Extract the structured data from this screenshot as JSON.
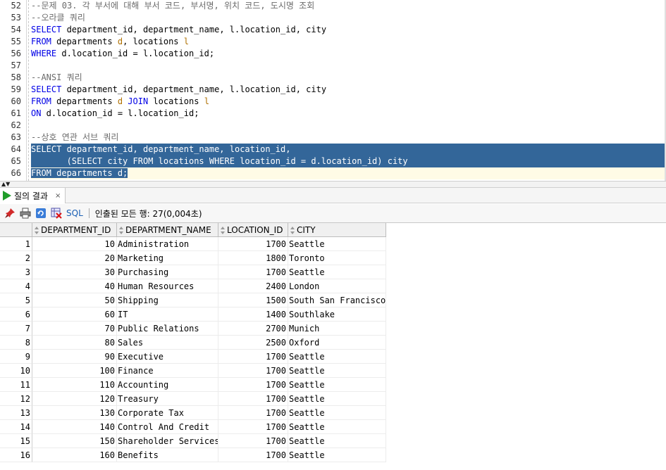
{
  "editor": {
    "lines": [
      {
        "n": "52",
        "segs": [
          {
            "t": "--문제 03. 각 부서에 대해 부서 코드, 부서명, 위치 코드, 도시명 조회",
            "c": "cm"
          }
        ]
      },
      {
        "n": "53",
        "segs": [
          {
            "t": "--오라클 쿼리",
            "c": "cm"
          }
        ]
      },
      {
        "n": "54",
        "segs": [
          {
            "t": "SELECT",
            "c": "kw"
          },
          {
            "t": " department_id, department_name, l.location_id, city",
            "c": ""
          }
        ]
      },
      {
        "n": "55",
        "segs": [
          {
            "t": "FROM",
            "c": "kw"
          },
          {
            "t": " departments ",
            "c": ""
          },
          {
            "t": "d",
            "c": "ali"
          },
          {
            "t": ", locations ",
            "c": ""
          },
          {
            "t": "l",
            "c": "ali"
          }
        ]
      },
      {
        "n": "56",
        "segs": [
          {
            "t": "WHERE",
            "c": "kw"
          },
          {
            "t": " d.location_id = l.location_id;",
            "c": ""
          }
        ]
      },
      {
        "n": "57",
        "segs": []
      },
      {
        "n": "58",
        "segs": [
          {
            "t": "--ANSI 쿼리",
            "c": "cm"
          }
        ]
      },
      {
        "n": "59",
        "segs": [
          {
            "t": "SELECT",
            "c": "kw"
          },
          {
            "t": " department_id, department_name, l.location_id, city",
            "c": ""
          }
        ]
      },
      {
        "n": "60",
        "segs": [
          {
            "t": "FROM",
            "c": "kw"
          },
          {
            "t": " departments ",
            "c": ""
          },
          {
            "t": "d",
            "c": "ali"
          },
          {
            "t": " ",
            "c": ""
          },
          {
            "t": "JOIN",
            "c": "kw"
          },
          {
            "t": " locations ",
            "c": ""
          },
          {
            "t": "l",
            "c": "ali"
          }
        ]
      },
      {
        "n": "61",
        "segs": [
          {
            "t": "ON",
            "c": "kw"
          },
          {
            "t": " d.location_id = l.location_id;",
            "c": ""
          }
        ]
      },
      {
        "n": "62",
        "segs": []
      },
      {
        "n": "63",
        "segs": [
          {
            "t": "--상호 연관 서브 쿼리",
            "c": "cm"
          }
        ]
      },
      {
        "n": "64",
        "sel": true,
        "segs": [
          {
            "t": "SELECT department_id, department_name, location_id,",
            "c": ""
          }
        ]
      },
      {
        "n": "65",
        "sel": true,
        "segs": [
          {
            "t": "       (SELECT city FROM locations WHERE location_id = d.location_id) city",
            "c": ""
          }
        ]
      },
      {
        "n": "66",
        "selpart": true,
        "segs": [
          {
            "t": "FROM departments d;",
            "c": ""
          }
        ]
      }
    ]
  },
  "tab": {
    "label": "질의 결과",
    "close": "×"
  },
  "toolbar": {
    "sql_label": "SQL",
    "status": "인출된 모든 행: 27(0,004초)"
  },
  "grid": {
    "columns": [
      "DEPARTMENT_ID",
      "DEPARTMENT_NAME",
      "LOCATION_ID",
      "CITY"
    ],
    "rows": [
      [
        "1",
        "10",
        "Administration",
        "1700",
        "Seattle"
      ],
      [
        "2",
        "20",
        "Marketing",
        "1800",
        "Toronto"
      ],
      [
        "3",
        "30",
        "Purchasing",
        "1700",
        "Seattle"
      ],
      [
        "4",
        "40",
        "Human Resources",
        "2400",
        "London"
      ],
      [
        "5",
        "50",
        "Shipping",
        "1500",
        "South San Francisco"
      ],
      [
        "6",
        "60",
        "IT",
        "1400",
        "Southlake"
      ],
      [
        "7",
        "70",
        "Public Relations",
        "2700",
        "Munich"
      ],
      [
        "8",
        "80",
        "Sales",
        "2500",
        "Oxford"
      ],
      [
        "9",
        "90",
        "Executive",
        "1700",
        "Seattle"
      ],
      [
        "10",
        "100",
        "Finance",
        "1700",
        "Seattle"
      ],
      [
        "11",
        "110",
        "Accounting",
        "1700",
        "Seattle"
      ],
      [
        "12",
        "120",
        "Treasury",
        "1700",
        "Seattle"
      ],
      [
        "13",
        "130",
        "Corporate Tax",
        "1700",
        "Seattle"
      ],
      [
        "14",
        "140",
        "Control And Credit",
        "1700",
        "Seattle"
      ],
      [
        "15",
        "150",
        "Shareholder Services",
        "1700",
        "Seattle"
      ],
      [
        "16",
        "160",
        "Benefits",
        "1700",
        "Seattle"
      ]
    ]
  },
  "colors": {
    "selection": "#336699",
    "keyword": "#0000e6",
    "comment": "#6b6b6b",
    "run_icon": "#1f9d2a"
  }
}
